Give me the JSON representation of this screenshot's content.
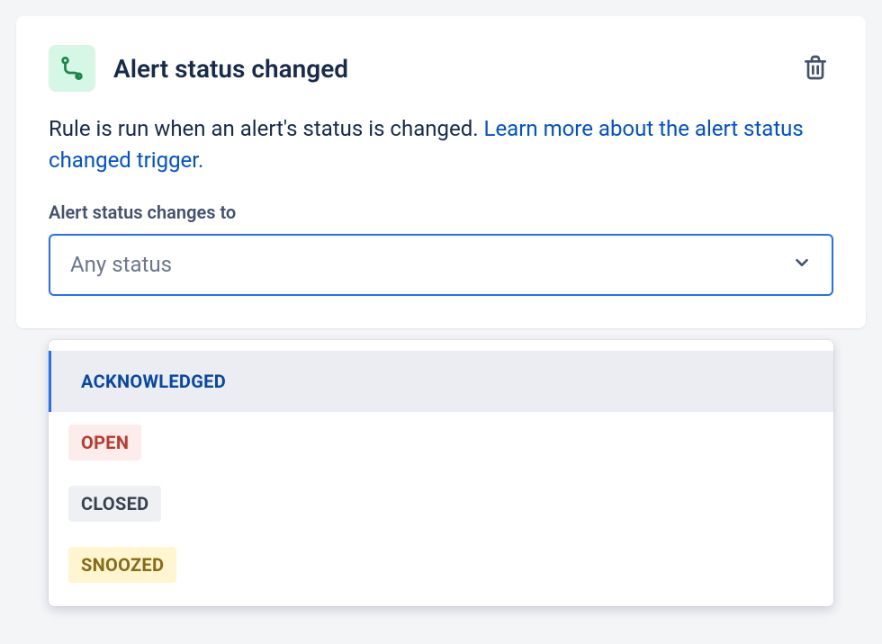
{
  "header": {
    "title": "Alert status changed"
  },
  "description": {
    "text": "Rule is run when an alert's status is changed. ",
    "link_text": "Learn more about the alert status changed trigger."
  },
  "field": {
    "label": "Alert status changes to",
    "placeholder": "Any status"
  },
  "options": [
    {
      "label": "ACKNOWLEDGED",
      "style": "acknowledged",
      "highlighted": true
    },
    {
      "label": "OPEN",
      "style": "open",
      "highlighted": false
    },
    {
      "label": "CLOSED",
      "style": "closed",
      "highlighted": false
    },
    {
      "label": "SNOOZED",
      "style": "snoozed",
      "highlighted": false
    }
  ]
}
